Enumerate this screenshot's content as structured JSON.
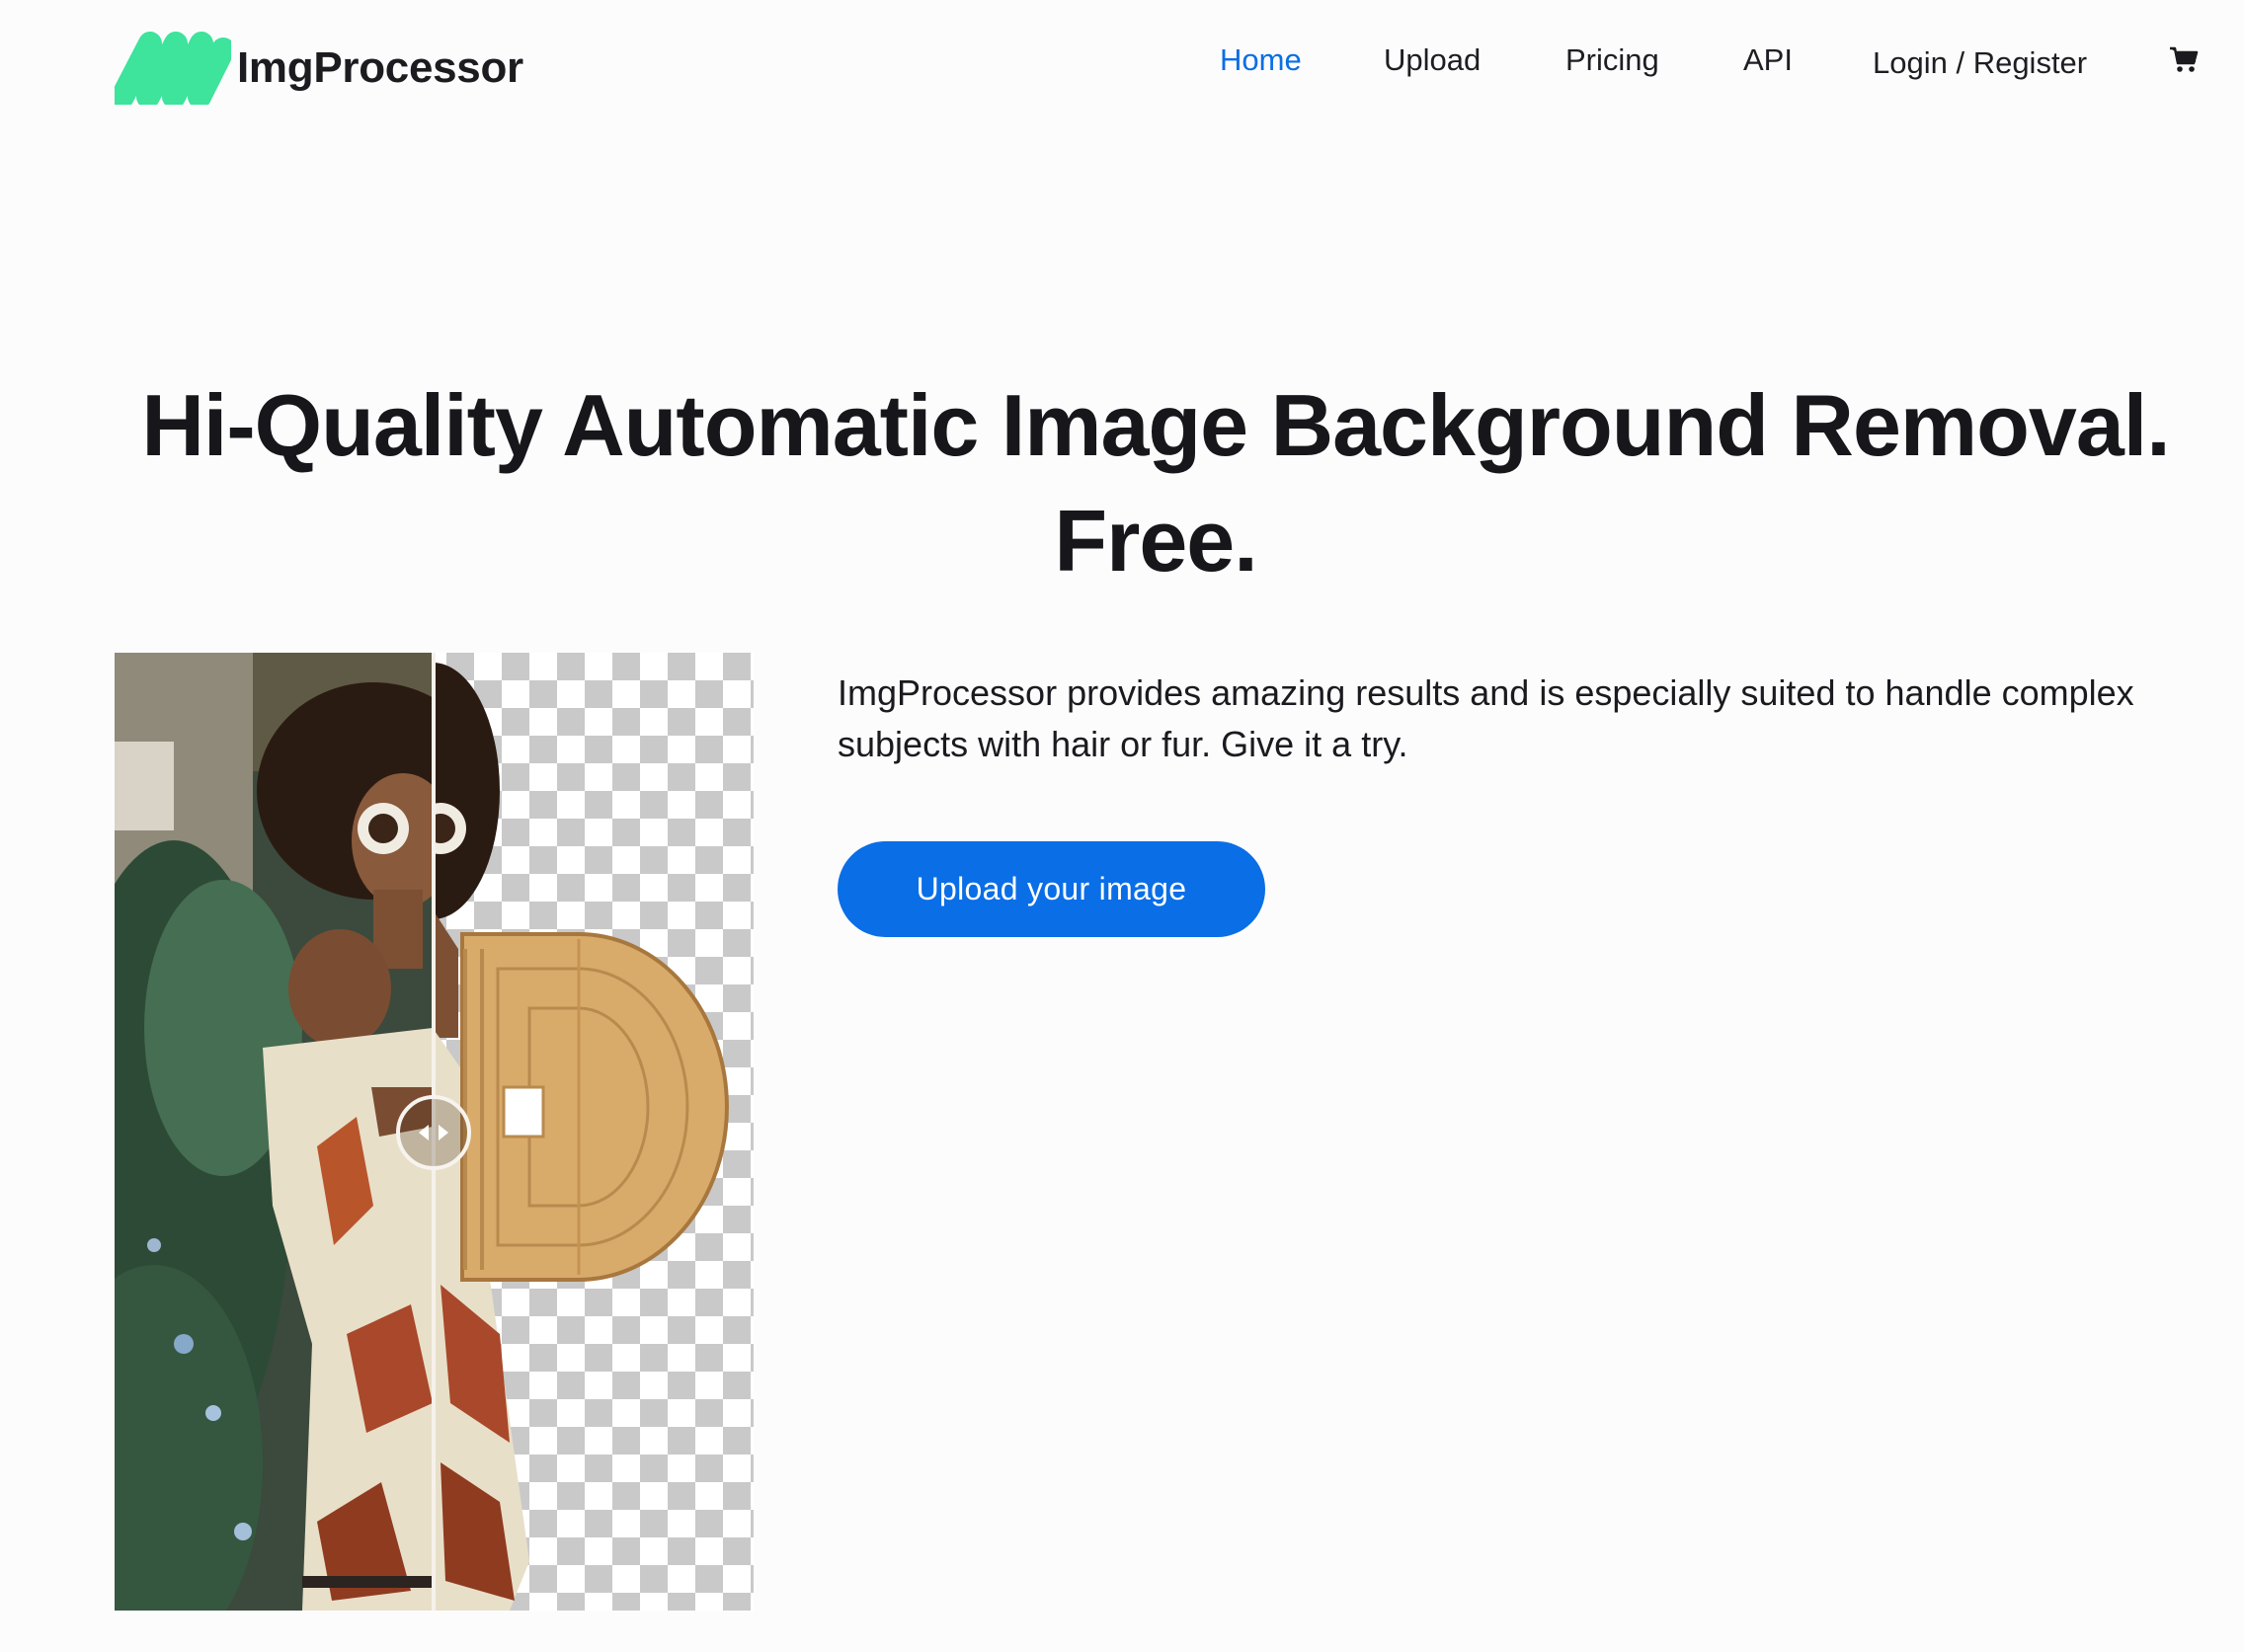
{
  "brand": {
    "name": "ImgProcessor",
    "logo_icon": "zigzag-logo-icon",
    "logo_color": "#3ee39c"
  },
  "nav": {
    "items": [
      {
        "label": "Home",
        "active": true
      },
      {
        "label": "Upload",
        "active": false
      },
      {
        "label": "Pricing",
        "active": false
      },
      {
        "label": "API",
        "active": false
      },
      {
        "label": "Login / Register",
        "active": false
      }
    ],
    "cart_icon": "shopping-cart-icon",
    "active_color": "#0a6ee6"
  },
  "hero": {
    "title_line1": "Hi-Quality Automatic Image Background Removal.",
    "title_line2": "Free.",
    "description": "ImgProcessor provides amazing results and is especially suited to handle complex subjects with hair or fur. Give it a try.",
    "cta_label": "Upload your image",
    "cta_color": "#0a6ee6"
  },
  "compare": {
    "before_label_icon": "photo-original",
    "after_label_icon": "transparent-checkerboard",
    "handle_icon": "drag-arrows-icon",
    "slider_position": 0.5
  }
}
